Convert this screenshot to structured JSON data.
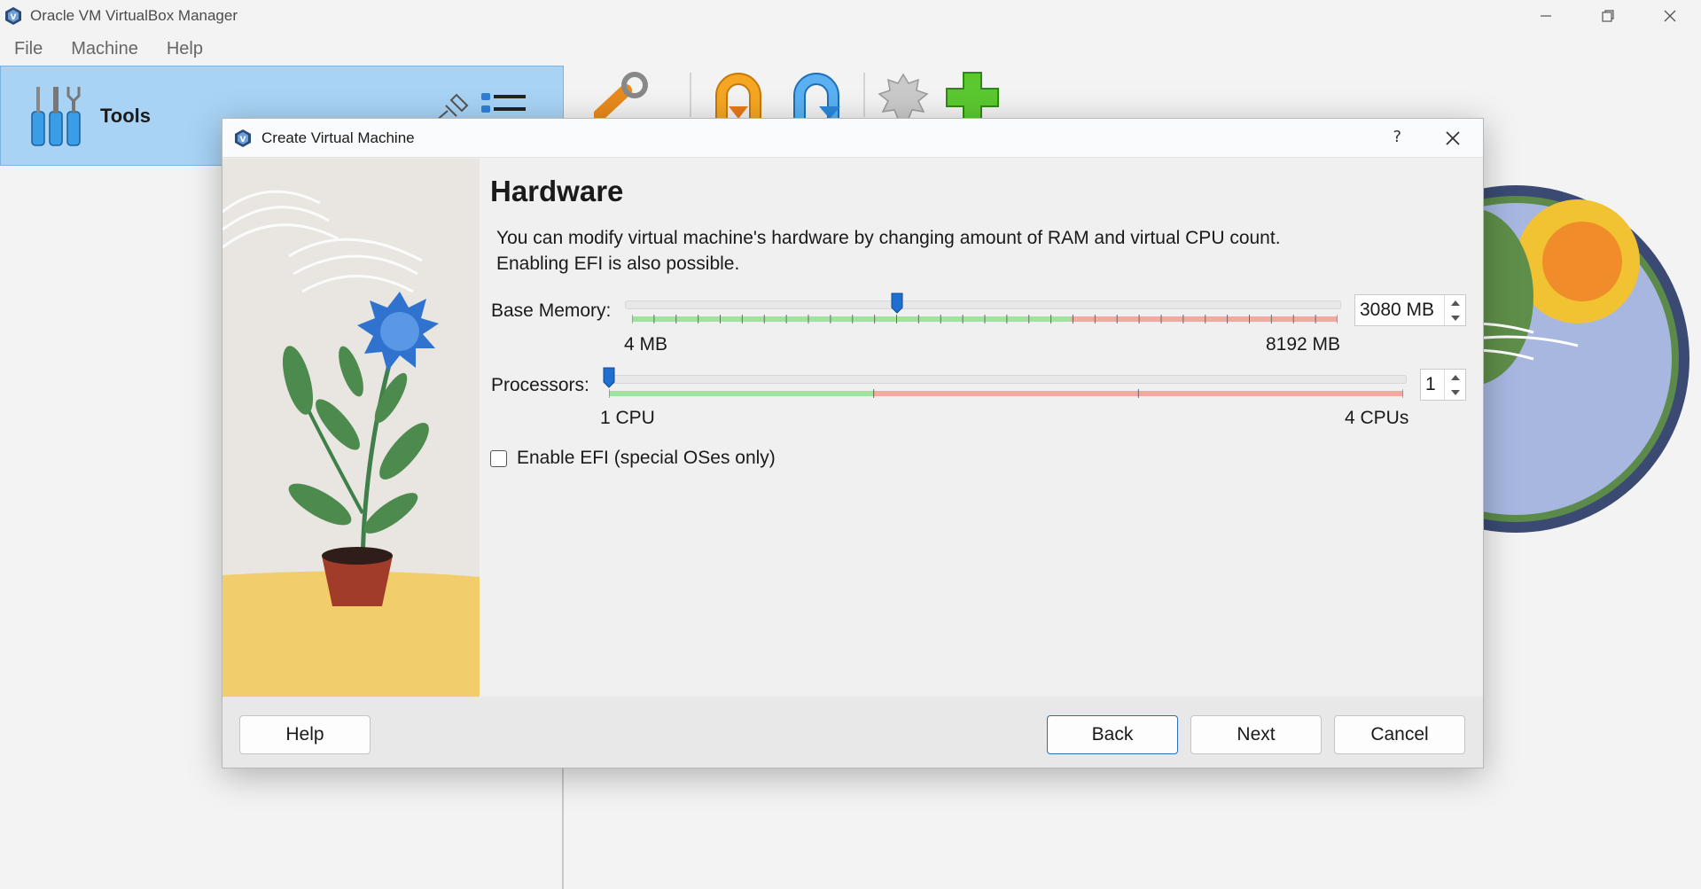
{
  "app": {
    "title": "Oracle VM VirtualBox Manager"
  },
  "menu": {
    "items": [
      "File",
      "Machine",
      "Help"
    ]
  },
  "tools": {
    "label": "Tools"
  },
  "toolbar": {
    "icons": [
      "settings-icon",
      "discard-icon",
      "import-icon",
      "export-icon",
      "new-vm-icon"
    ]
  },
  "dialog": {
    "title": "Create Virtual Machine",
    "help_glyph": "?",
    "page_title": "Hardware",
    "description_line1": "You can modify virtual machine's hardware by changing amount of RAM and virtual CPU count.",
    "description_line2": "Enabling EFI is also possible.",
    "memory": {
      "label": "Base Memory:",
      "min_label": "4 MB",
      "max_label": "8192 MB",
      "value": "3080 MB",
      "current_mb": 3080,
      "min_mb": 4,
      "max_mb": 8192
    },
    "processors": {
      "label": "Processors:",
      "min_label": "1 CPU",
      "max_label": "4 CPUs",
      "value": "1",
      "current": 1,
      "min": 1,
      "max": 4
    },
    "efi": {
      "label": "Enable EFI (special OSes only)",
      "checked": false
    },
    "buttons": {
      "help": "Help",
      "back": "Back",
      "next": "Next",
      "cancel": "Cancel"
    }
  },
  "colors": {
    "tools_panel": "#a8d3f5",
    "slider_handle": "#1e6fd0",
    "scale_green": "#9fe39f",
    "scale_red": "#f1a9a0",
    "accent_border": "#2a6ebb"
  }
}
